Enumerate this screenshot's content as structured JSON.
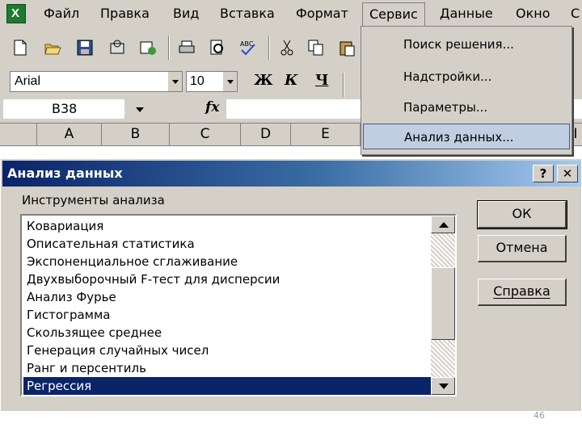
{
  "menubar": {
    "items": [
      {
        "label": "Файл"
      },
      {
        "label": "Правка"
      },
      {
        "label": "Вид"
      },
      {
        "label": "Вставка"
      },
      {
        "label": "Формат"
      },
      {
        "label": "Сервис"
      },
      {
        "label": "Данные"
      },
      {
        "label": "Окно"
      },
      {
        "label": "С"
      }
    ]
  },
  "toolbar": {
    "font": "Arial",
    "font_size": "10",
    "bold": "Ж",
    "italic": "К",
    "underline": "Ч"
  },
  "formula_bar": {
    "cell_ref": "B38",
    "fx": "fx",
    "value": ""
  },
  "columns": [
    "A",
    "B",
    "C",
    "D",
    "E",
    "I"
  ],
  "service_menu": {
    "items": [
      {
        "label": "Поиск решения..."
      },
      {
        "label": "Надстройки..."
      },
      {
        "label": "Параметры..."
      },
      {
        "label": "Анализ данных..."
      }
    ],
    "selected_index": 3
  },
  "dialog": {
    "title": "Анализ данных",
    "help_glyph": "?",
    "close_glyph": "✕",
    "group_label": "Инструменты анализа",
    "tools": [
      "Ковариация",
      "Описательная статистика",
      "Экспоненциальное сглаживание",
      "Двухвыборочный F-тест для дисперсии",
      "Анализ Фурье",
      "Гистограмма",
      "Скользящее среднее",
      "Генерация случайных чисел",
      "Ранг и персентиль",
      "Регрессия"
    ],
    "selected_tool": "Регрессия",
    "buttons": {
      "ok": "ОК",
      "cancel": "Отмена",
      "help": "Справка"
    }
  },
  "page_number": "46",
  "colors": {
    "titlebar_start": "#0a246a",
    "titlebar_end": "#a6caf0",
    "selection": "#0a246a",
    "chrome": "#d4d0c8"
  }
}
